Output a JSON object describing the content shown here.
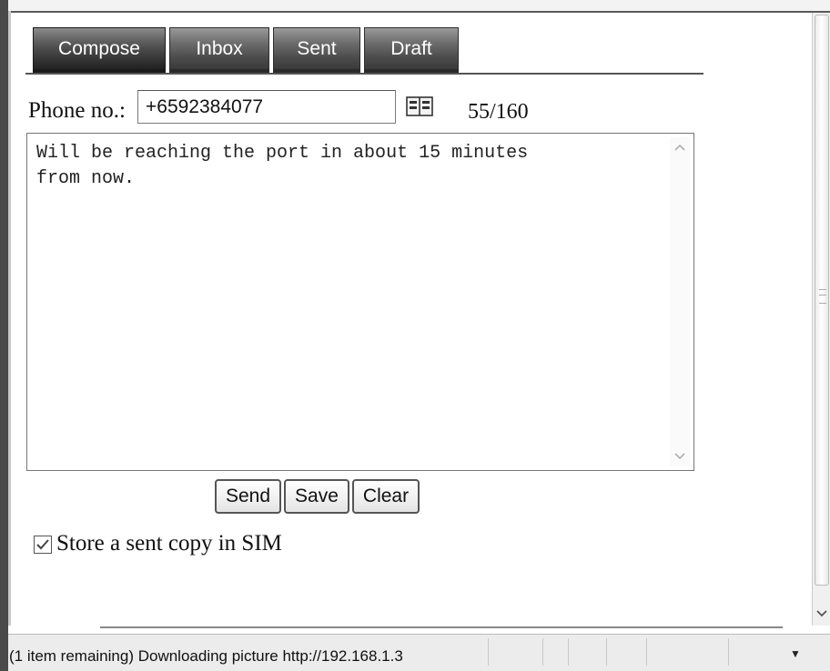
{
  "tabs": [
    {
      "label": "Compose",
      "active": true
    },
    {
      "label": "Inbox",
      "active": false
    },
    {
      "label": "Sent",
      "active": false
    },
    {
      "label": "Draft",
      "active": false
    }
  ],
  "form": {
    "phone_label": "Phone no.:",
    "phone_value": "+6592384077",
    "char_count": "55/160",
    "message": "Will be reaching the port in about 15 minutes\nfrom now.",
    "buttons": {
      "send": "Send",
      "save": "Save",
      "clear": "Clear"
    },
    "store_copy_label": "Store a sent copy in SIM",
    "store_copy_checked": true
  },
  "status_bar": {
    "text": "(1 item remaining) Downloading picture http://192.168.1.3"
  },
  "icons": {
    "contacts": "address-book-icon",
    "scroll_up": "chevron-up-icon",
    "scroll_down": "chevron-down-icon"
  }
}
